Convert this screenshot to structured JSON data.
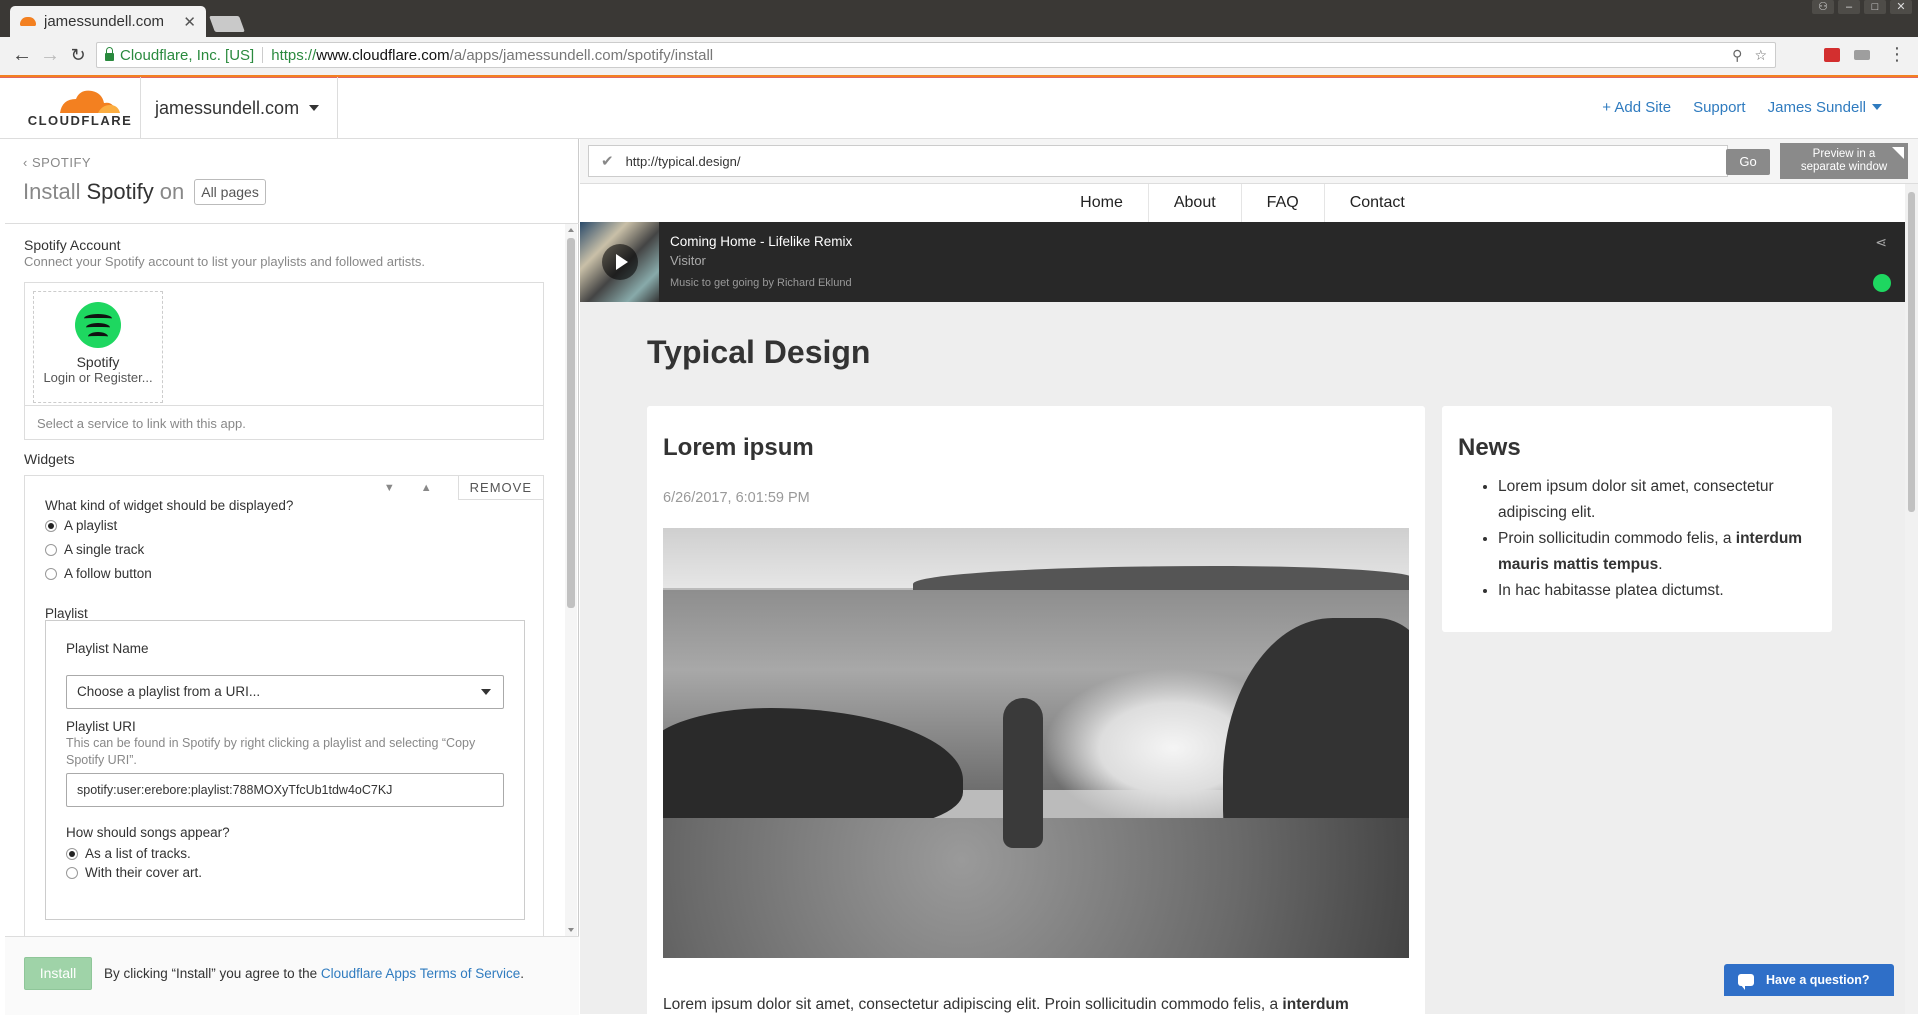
{
  "browser": {
    "tab_title": "jamessundell.com",
    "secure_label": "Cloudflare, Inc. [US]",
    "url_scheme": "https://",
    "url_host": "www.cloudflare.com",
    "url_path": "/a/apps/jamessundell.com/spotify/install"
  },
  "header": {
    "logo_text": "CLOUDFLARE",
    "site": "jamessundell.com",
    "add_site": "+ Add Site",
    "support": "Support",
    "user": "James Sundell"
  },
  "install": {
    "breadcrumb": "SPOTIFY",
    "title_prefix": "Install",
    "app_name": "Spotify",
    "title_on": "on",
    "pages": "All pages",
    "account_label": "Spotify Account",
    "account_help": "Connect your Spotify account to list your playlists and followed artists.",
    "service_name": "Spotify",
    "service_action": "Login or Register...",
    "service_select": "Select a service to link with this app.",
    "widgets_label": "Widgets",
    "remove": "REMOVE",
    "widget_question": "What kind of widget should be displayed?",
    "widget_options": [
      "A playlist",
      "A single track",
      "A follow button"
    ],
    "widget_selected": 0,
    "playlist_section": "Playlist",
    "playlist_name_label": "Playlist Name",
    "playlist_select": "Choose a playlist from a URI...",
    "playlist_uri_label": "Playlist URI",
    "playlist_uri_help": "This can be found in Spotify by right clicking a playlist and selecting “Copy Spotify URI”.",
    "playlist_uri_value": "spotify:user:erebore:playlist:788MOXyTfcUb1tdw4oC7KJ",
    "songs_question": "How should songs appear?",
    "songs_options": [
      "As a list of tracks.",
      "With their cover art."
    ],
    "install_button": "Install",
    "tos_text": "By clicking “Install” you agree to the",
    "tos_link": "Cloudflare Apps Terms of Service",
    "tos_end": "."
  },
  "preview": {
    "url": "http://typical.design/",
    "go": "Go",
    "separate_line1": "Preview in a",
    "separate_line2": "separate window"
  },
  "site": {
    "nav": [
      "Home",
      "About",
      "FAQ",
      "Contact"
    ],
    "player": {
      "track": "Coming Home - Lifelike Remix",
      "artist": "Visitor",
      "playlist": "Music to get going by Richard Eklund"
    },
    "title": "Typical Design",
    "post": {
      "title": "Lorem ipsum",
      "date": "6/26/2017, 6:01:59 PM",
      "body_text": "Lorem ipsum dolor sit amet, consectetur adipiscing elit. Proin sollicitudin commodo felis, a ",
      "body_bold": "interdum"
    },
    "news": {
      "title": "News",
      "item1": "Lorem ipsum dolor sit amet, consectetur adipiscing elit.",
      "item2_text": "Proin sollicitudin commodo felis, a ",
      "item2_bold": "interdum mauris mattis tempus",
      "item2_end": ".",
      "item3": "In hac habitasse platea dictumst."
    },
    "chat": "Have a question?"
  },
  "colors": {
    "accent": "#f38020",
    "link": "#2f7bbf",
    "install_button": "#9fd3a8",
    "spotify": "#1ed760",
    "chat": "#2f6fc8"
  }
}
